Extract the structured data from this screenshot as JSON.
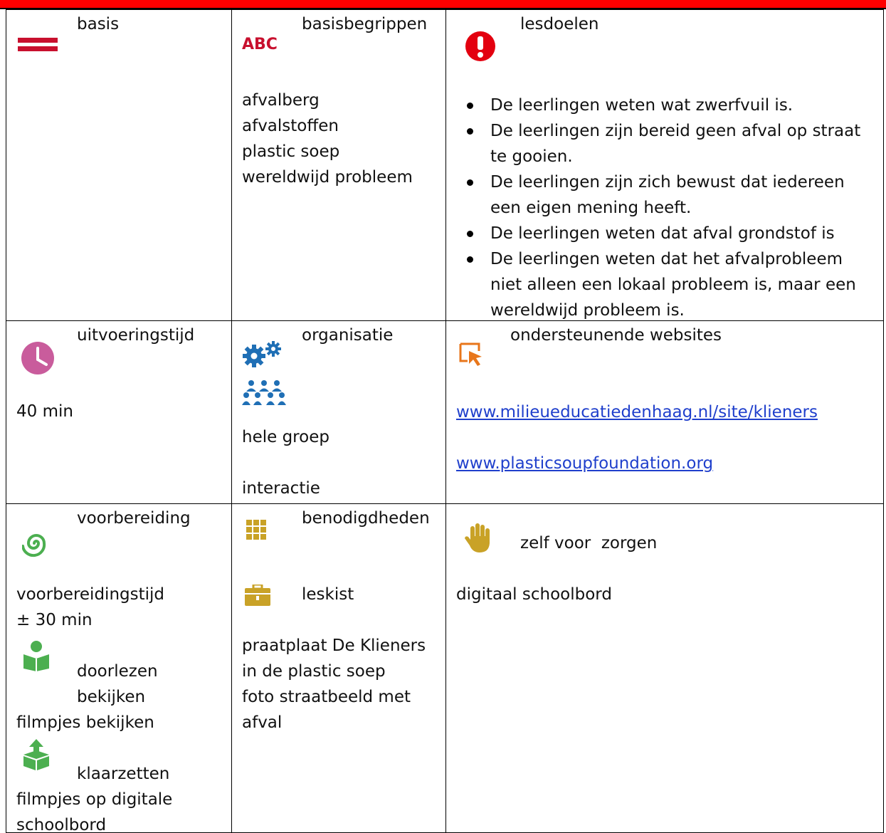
{
  "colors": {
    "accent_red": "#ff0000",
    "basis_red": "#c8102e",
    "clock_pink": "#c95c9c",
    "gear_blue": "#1f6fb5",
    "spiral_green": "#4caf50",
    "gold": "#c9a227",
    "orange": "#e8761b",
    "link_blue": "#1f3fcc"
  },
  "row1": {
    "basis": {
      "icon": "double-bar-icon",
      "label": "basis"
    },
    "basisbegrippen": {
      "icon": "abc-icon",
      "label": "basisbegrippen",
      "items": [
        "afvalberg",
        "afvalstoffen",
        "plastic soep",
        "wereldwijd probleem"
      ]
    },
    "lesdoelen": {
      "icon": "exclamation-icon",
      "label": "lesdoelen",
      "items": [
        "De leerlingen weten wat zwerfvuil is.",
        "De leerlingen zijn bereid geen afval op straat te gooien.",
        "De leerlingen zijn zich bewust dat iedereen een eigen mening heeft.",
        "De leerlingen weten dat afval grondstof is",
        "De leerlingen weten dat het afvalprobleem niet alleen een lokaal probleem is, maar een wereldwijd probleem is."
      ]
    }
  },
  "row2": {
    "uitvoeringstijd": {
      "icon": "clock-icon",
      "label": "uitvoeringstijd",
      "value": "40 min"
    },
    "organisatie": {
      "icon": "gears-icon",
      "label": "organisatie",
      "group_icon": "group-icon",
      "group": "hele groep",
      "mode": "interactie"
    },
    "websites": {
      "icon": "cursor-icon",
      "label": "ondersteunende websites",
      "links": [
        "www.milieueducatiedenhaag.nl/site/klieners",
        "www.plasticsoupfoundation.org"
      ]
    }
  },
  "row3": {
    "voorbereiding": {
      "icon": "spiral-icon",
      "label": "voorbereiding",
      "time_label": "voorbereidingstijd",
      "time_value": "± 30 min",
      "read_icon": "reader-icon",
      "read_line1": "doorlezen",
      "read_line2": "bekijken",
      "read_line3": "filmpjes bekijken",
      "box_icon": "box-upload-icon",
      "prep_line1": "klaarzetten",
      "prep_line2": "filmpjes op digitale",
      "prep_line3": "schoolbord"
    },
    "benodigdheden": {
      "icon": "grid-icon",
      "label": "benodigdheden",
      "kit_icon": "briefcase-icon",
      "kit": "leskist",
      "items": [
        "praatplaat De Klieners",
        "in de plastic soep",
        "foto straatbeeld met",
        "afval"
      ]
    },
    "zelf": {
      "icon": "hand-icon",
      "label": "zelf voor  zorgen",
      "item": "digitaal schoolbord"
    }
  }
}
